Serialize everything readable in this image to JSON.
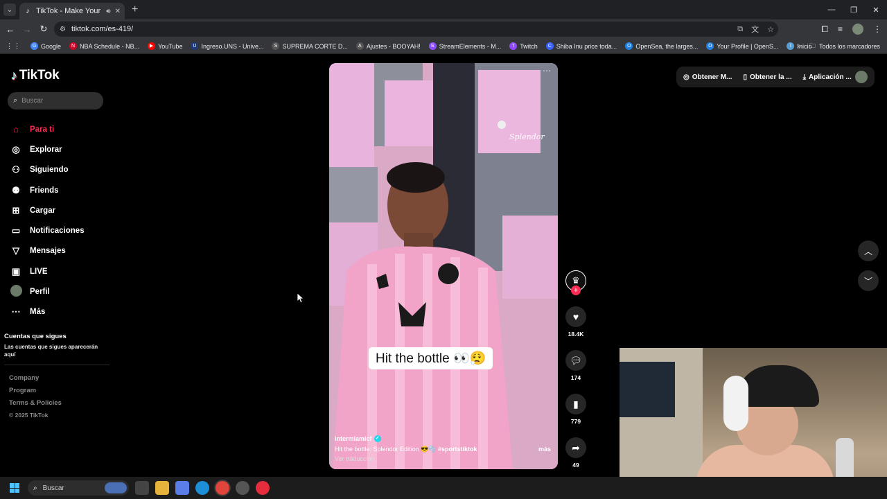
{
  "browser": {
    "tab_title": "TikTok - Make Your Day",
    "url": "tiktok.com/es-419/",
    "bookmarks": [
      {
        "label": "Google",
        "color": "#4285f4",
        "icon": "G"
      },
      {
        "label": "NBA Schedule - NB...",
        "color": "#c9082a",
        "icon": "N"
      },
      {
        "label": "YouTube",
        "color": "#ff0000",
        "icon": "▶"
      },
      {
        "label": "Ingreso.UNS - Unive...",
        "color": "#1d3a7a",
        "icon": "U"
      },
      {
        "label": "SUPREMA CORTE D...",
        "color": "#555555",
        "icon": "S"
      },
      {
        "label": "Ajustes - BOOYAH!",
        "color": "#555555",
        "icon": "A"
      },
      {
        "label": "StreamElements - M...",
        "color": "#8c4fff",
        "icon": "S"
      },
      {
        "label": "Twitch",
        "color": "#9146ff",
        "icon": "T"
      },
      {
        "label": "Shiba Inu price toda...",
        "color": "#3861fb",
        "icon": "C"
      },
      {
        "label": "OpenSea, the larges...",
        "color": "#2081e2",
        "icon": "O"
      },
      {
        "label": "Your Profile | OpenS...",
        "color": "#2081e2",
        "icon": "O"
      },
      {
        "label": "Inicio",
        "color": "#5a9fd4",
        "icon": "i"
      }
    ],
    "bookmarks_folder": "Todos los marcadores"
  },
  "sidebar": {
    "brand": "TikTok",
    "search_placeholder": "Buscar",
    "items": [
      {
        "label": "Para ti",
        "icon": "home-icon"
      },
      {
        "label": "Explorar",
        "icon": "compass-icon"
      },
      {
        "label": "Siguiendo",
        "icon": "following-icon"
      },
      {
        "label": "Friends",
        "icon": "friends-icon"
      },
      {
        "label": "Cargar",
        "icon": "upload-icon"
      },
      {
        "label": "Notificaciones",
        "icon": "inbox-icon"
      },
      {
        "label": "Mensajes",
        "icon": "send-icon"
      },
      {
        "label": "LIVE",
        "icon": "live-icon"
      },
      {
        "label": "Perfil",
        "icon": "avatar"
      },
      {
        "label": "Más",
        "icon": "more-icon"
      }
    ],
    "following_title": "Cuentas que sigues",
    "following_subtitle": "Las cuentas que sigues aparecerán aquí",
    "footer": [
      "Company",
      "Program",
      "Terms & Policies"
    ],
    "copyright": "© 2025 TikTok"
  },
  "video": {
    "caption_overlay": "Hit the bottle 👀😮‍💨",
    "author": "intermiamicf",
    "description": "Hit the bottle: Splendor Edition 😎🫧",
    "hashtag": "#sportstiktok",
    "more": "más",
    "translate": "Ver traducción"
  },
  "actions": {
    "likes": "18.4K",
    "comments": "174",
    "saves": "779",
    "shares": "49"
  },
  "top_actions": {
    "coins": "Obtener M...",
    "app": "Obtener la ...",
    "desktop_app": "Aplicación ..."
  },
  "taskbar": {
    "search_placeholder": "Buscar"
  }
}
